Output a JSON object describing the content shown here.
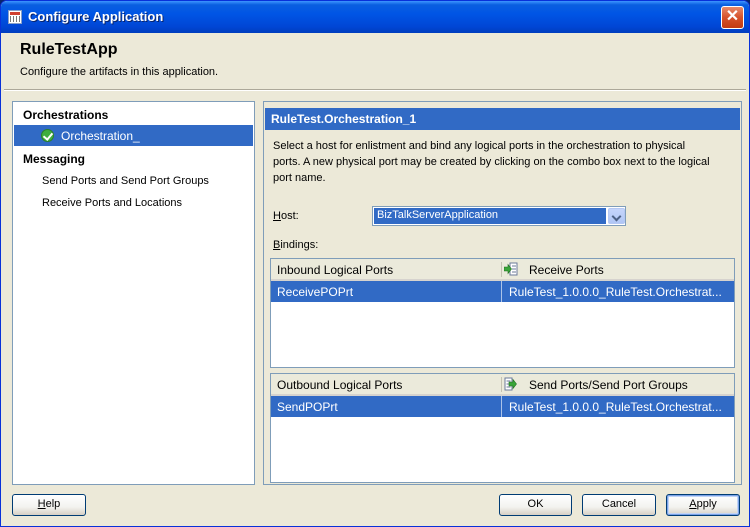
{
  "window": {
    "title": "Configure Application",
    "close_glyph": "✕"
  },
  "header": {
    "title": "RuleTestApp",
    "subtitle": "Configure the artifacts in this application."
  },
  "nav": {
    "orchestrations_label": "Orchestrations",
    "selected_item": {
      "label": "Orchestration_",
      "icon": "green-check-icon"
    },
    "messaging_label": "Messaging",
    "items": [
      "Send Ports and Send Port Groups",
      "Receive Ports and Locations"
    ]
  },
  "detail": {
    "title": "RuleTest.Orchestration_1",
    "description": "Select a host for enlistment and bind any logical ports in the orchestration to physical ports. A new physical port may be created by clicking on the combo box next to the logical port name.",
    "host_label": "Host:",
    "host_value": "BizTalkServerApplication",
    "bindings_label": "Bindings:",
    "inbound": {
      "col1": "Inbound Logical Ports",
      "col2": "Receive Ports",
      "rows": [
        {
          "logical": "ReceivePOPrt",
          "physical": "RuleTest_1.0.0.0_RuleTest.Orchestrat..."
        }
      ]
    },
    "outbound": {
      "col1": "Outbound Logical Ports",
      "col2": "Send Ports/Send Port Groups",
      "rows": [
        {
          "logical": "SendPOPrt",
          "physical": "RuleTest_1.0.0.0_RuleTest.Orchestrat..."
        }
      ]
    }
  },
  "buttons": {
    "help": "Help",
    "ok": "OK",
    "cancel": "Cancel",
    "apply": "Apply"
  },
  "colors": {
    "selection": "#316ac5",
    "titlebar": "#0055e5",
    "dialog_bg": "#ece9d8"
  }
}
